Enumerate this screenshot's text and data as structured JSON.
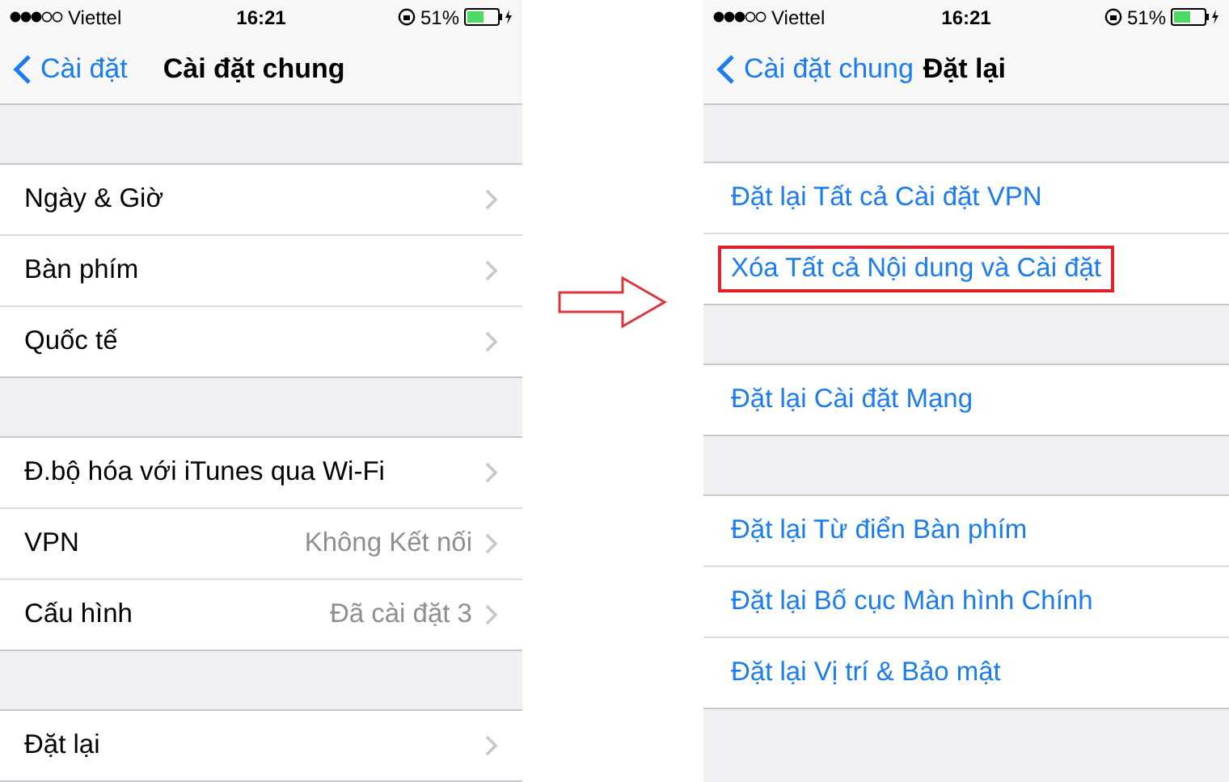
{
  "screens": [
    {
      "status_bar": {
        "carrier": "Viettel",
        "time": "16:21",
        "battery": "51%"
      },
      "nav": {
        "back": "Cài đặt",
        "title": "Cài đặt chung"
      },
      "groups": [
        {
          "rows": [
            {
              "kind": "link",
              "label": "Ngày & Giờ"
            },
            {
              "kind": "link",
              "label": "Bàn phím"
            },
            {
              "kind": "link",
              "label": "Quốc tế"
            }
          ]
        },
        {
          "rows": [
            {
              "kind": "link",
              "label": "Đ.bộ hóa với iTunes qua Wi-Fi"
            },
            {
              "kind": "link",
              "label": "VPN",
              "value": "Không Kết nối"
            },
            {
              "kind": "link",
              "label": "Cấu hình",
              "value": "Đã cài đặt 3"
            }
          ]
        },
        {
          "rows": [
            {
              "kind": "link",
              "label": "Đặt lại"
            }
          ]
        }
      ]
    },
    {
      "status_bar": {
        "carrier": "Viettel",
        "time": "16:21",
        "battery": "51%"
      },
      "nav": {
        "back": "Cài đặt chung",
        "title": "Đặt lại"
      },
      "groups": [
        {
          "rows": [
            {
              "kind": "action",
              "label": "Đặt lại Tất cả Cài đặt VPN",
              "highlighted": false
            },
            {
              "kind": "action",
              "label": "Xóa Tất cả Nội dung và Cài đặt",
              "highlighted": true
            }
          ]
        },
        {
          "rows": [
            {
              "kind": "action",
              "label": "Đặt lại Cài đặt Mạng",
              "highlighted": false
            }
          ]
        },
        {
          "rows": [
            {
              "kind": "action",
              "label": "Đặt lại Từ điển Bàn phím",
              "highlighted": false
            },
            {
              "kind": "action",
              "label": "Đặt lại Bố cục Màn hình Chính",
              "highlighted": false
            },
            {
              "kind": "action",
              "label": "Đặt lại Vị trí & Bảo mật",
              "highlighted": false
            }
          ]
        }
      ]
    }
  ]
}
